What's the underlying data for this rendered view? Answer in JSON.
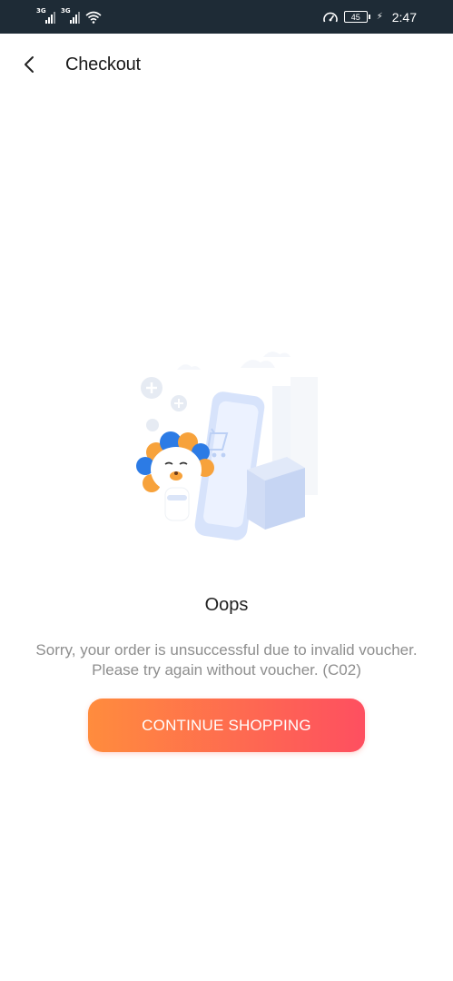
{
  "status_bar": {
    "signal_1_label": "3G",
    "signal_2_label": "3G",
    "battery": "45",
    "time": "2:47",
    "bg_color": "#1e2b36"
  },
  "header": {
    "back_icon": "chevron-left-icon",
    "title": "Checkout"
  },
  "result": {
    "illustration": "mascot-lion-phone-cart-package",
    "title": "Oops",
    "message": "Sorry, your order is unsuccessful due to invalid voucher. Please try again without voucher. (C02)",
    "button_label": "CONTINUE SHOPPING",
    "button_gradient": [
      "#ff8c3d",
      "#fe4f60"
    ]
  }
}
